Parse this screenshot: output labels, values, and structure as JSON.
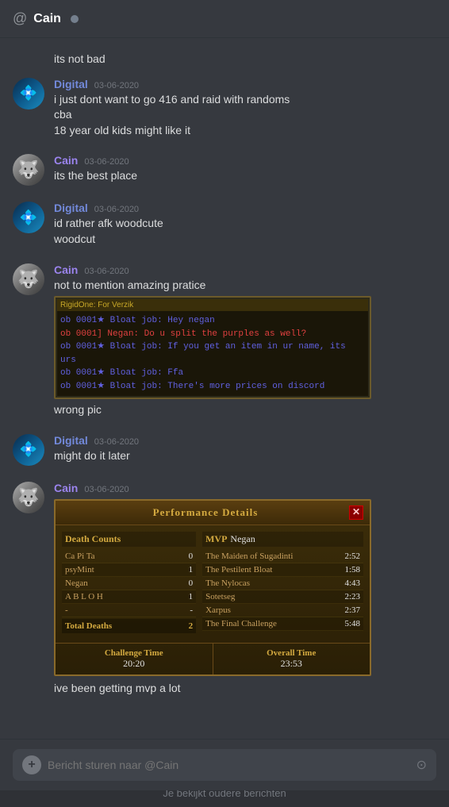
{
  "header": {
    "channel_name": "Cain",
    "status": "offline"
  },
  "messages": [
    {
      "id": "msg1",
      "type": "continuation",
      "text": "its not bad"
    },
    {
      "id": "msg2",
      "type": "group",
      "username": "Digital",
      "username_class": "username-digital",
      "avatar_class": "digital-avatar",
      "timestamp": "03-06-2020",
      "lines": [
        "i just dont want to go 416 and raid with randoms",
        "cba",
        "18 year old kids might like it"
      ]
    },
    {
      "id": "msg3",
      "type": "group",
      "username": "Cain",
      "username_class": "username-cain",
      "avatar_class": "wolf-avatar",
      "timestamp": "03-06-2020",
      "lines": [
        "its the best place"
      ]
    },
    {
      "id": "msg4",
      "type": "group",
      "username": "Digital",
      "username_class": "username-digital",
      "avatar_class": "digital-avatar",
      "timestamp": "03-06-2020",
      "lines": [
        "id rather afk woodcute",
        "woodcut"
      ]
    },
    {
      "id": "msg5",
      "type": "group",
      "username": "Cain",
      "username_class": "username-cain",
      "avatar_class": "wolf-avatar",
      "timestamp": "03-06-2020",
      "lines": [
        "not to mention amazing pratice"
      ],
      "has_screenshot": true,
      "screenshot": {
        "header": "RigidOne: For Verzik",
        "lines": [
          {
            "class": "screenshot-line-blue",
            "text": "ob 0001★ Bloat job: Hey negan"
          },
          {
            "class": "screenshot-line-red",
            "text": "ob 0001] Negan: Do u split the purples as well?"
          },
          {
            "class": "screenshot-line-blue",
            "text": "ob 0001★ Bloat job: If you get an item in ur name, its urs"
          },
          {
            "class": "screenshot-line-blue",
            "text": "ob 0001★ Bloat job: Ffa"
          },
          {
            "class": "screenshot-line-blue",
            "text": "ob 0001★ Bloat job: There's more prices on discord"
          }
        ]
      },
      "continuation_lines": [
        "wrong pic"
      ]
    },
    {
      "id": "msg6",
      "type": "group",
      "username": "Digital",
      "username_class": "username-digital",
      "avatar_class": "digital-avatar",
      "timestamp": "03-06-2020",
      "lines": [
        "might do it later"
      ]
    },
    {
      "id": "msg7",
      "type": "group",
      "username": "Cain",
      "username_class": "username-cain",
      "avatar_class": "wolf-avatar",
      "timestamp": "03-06-2020",
      "lines": [],
      "has_perf_modal": true,
      "perf_modal": {
        "title": "Performance Details",
        "mvp_label": "MVP",
        "mvp_name": "Negan",
        "death_table_header": "Death Counts",
        "death_rows": [
          {
            "name": "Ca Pi Ta",
            "count": "0"
          },
          {
            "name": "psyMint",
            "count": "1"
          },
          {
            "name": "Negan",
            "count": "0"
          },
          {
            "name": "A B L O H",
            "count": "1"
          },
          {
            "name": "-",
            "count": "-"
          }
        ],
        "total_deaths_label": "Total Deaths",
        "total_deaths": "2",
        "boss_rows": [
          {
            "name": "The Maiden of Sugadinti",
            "time": "2:52"
          },
          {
            "name": "The Pestilent Bloat",
            "time": "1:58"
          },
          {
            "name": "The Nylocas",
            "time": "4:43"
          },
          {
            "name": "Sotetseg",
            "time": "2:23"
          },
          {
            "name": "Xarpus",
            "time": "2:37"
          },
          {
            "name": "The Final Challenge",
            "time": "5:48"
          }
        ],
        "challenge_time_label": "Challenge Time",
        "challenge_time": "20:20",
        "overall_time_label": "Overall Time",
        "overall_time": "23:53"
      },
      "continuation_lines": [
        "ive been getting mvp a lot"
      ]
    }
  ],
  "old_messages_banner": "Je bekijkt oudere berichten",
  "input": {
    "placeholder": "Bericht sturen naar @Cain"
  }
}
